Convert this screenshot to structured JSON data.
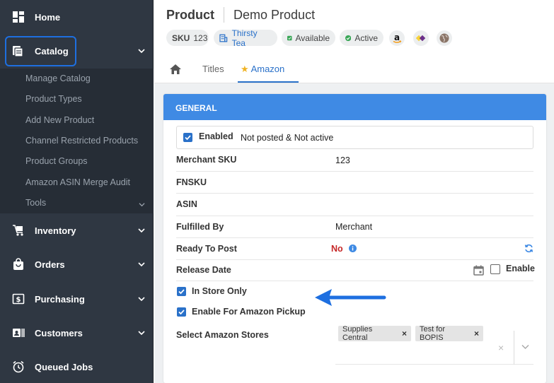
{
  "sidebar": {
    "items": [
      {
        "label": "Home",
        "icon": "dashboard-icon"
      },
      {
        "label": "Catalog",
        "icon": "catalog-icon"
      },
      {
        "label": "Inventory",
        "icon": "cart-icon"
      },
      {
        "label": "Orders",
        "icon": "shopping-bag-icon"
      },
      {
        "label": "Purchasing",
        "icon": "dollar-doc-icon"
      },
      {
        "label": "Customers",
        "icon": "contacts-icon"
      },
      {
        "label": "Queued Jobs",
        "icon": "alarm-clock-icon"
      }
    ],
    "catalog_sub": [
      "Manage Catalog",
      "Product Types",
      "Add New Product",
      "Channel Restricted Products",
      "Product Groups",
      "Amazon ASIN Merge Audit",
      "Tools"
    ]
  },
  "header": {
    "title": "Product",
    "subtitle": "Demo Product",
    "chips": {
      "sku_key": "SKU",
      "sku_value": "123",
      "brand": "Thirsty Tea",
      "available": "Available",
      "active": "Active"
    }
  },
  "tabs": [
    "Titles",
    "Amazon"
  ],
  "general": {
    "section_title": "GENERAL",
    "enabled_label": "Enabled",
    "enabled_status": "Not posted & Not active",
    "merchant_sku_label": "Merchant SKU",
    "merchant_sku_value": "123",
    "fnsku_label": "FNSKU",
    "asin_label": "ASIN",
    "fulfilled_by_label": "Fulfilled By",
    "fulfilled_by_value": "Merchant",
    "ready_to_post_label": "Ready To Post",
    "ready_to_post_value": "No",
    "release_date_label": "Release Date",
    "release_enable_label": "Enable",
    "in_store_only_label": "In Store Only",
    "amazon_pickup_label": "Enable For Amazon Pickup",
    "select_stores_label": "Select Amazon Stores",
    "stores": [
      "Supplies Central",
      "Test for BOPIS"
    ]
  },
  "colors": {
    "sidebar_bg": "#2f3742",
    "accent": "#2a71c9",
    "section_header": "#3f8ae4",
    "status_no": "#c62828",
    "arrow": "#1e6fe0"
  }
}
